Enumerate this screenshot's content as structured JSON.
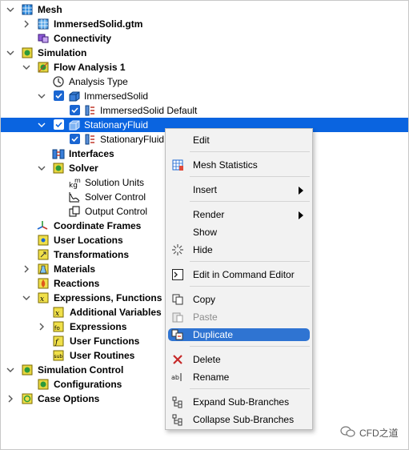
{
  "tree": {
    "items": [
      {
        "label": "Mesh",
        "bold": true
      },
      {
        "label": "ImmersedSolid.gtm",
        "bold": true
      },
      {
        "label": "Connectivity",
        "bold": true
      },
      {
        "label": "Simulation",
        "bold": true
      },
      {
        "label": "Flow Analysis 1",
        "bold": true
      },
      {
        "label": "Analysis Type",
        "bold": false
      },
      {
        "label": "ImmersedSolid",
        "bold": false
      },
      {
        "label": "ImmersedSolid Default",
        "bold": false
      },
      {
        "label": "StationaryFluid",
        "bold": false
      },
      {
        "label": "StationaryFluid D",
        "bold": false
      },
      {
        "label": "Interfaces",
        "bold": true
      },
      {
        "label": "Solver",
        "bold": true
      },
      {
        "label": "Solution Units",
        "bold": false
      },
      {
        "label": "Solver Control",
        "bold": false
      },
      {
        "label": "Output Control",
        "bold": false
      },
      {
        "label": "Coordinate Frames",
        "bold": true
      },
      {
        "label": "User Locations",
        "bold": true
      },
      {
        "label": "Transformations",
        "bold": true
      },
      {
        "label": "Materials",
        "bold": true
      },
      {
        "label": "Reactions",
        "bold": true
      },
      {
        "label": "Expressions, Functions an",
        "bold": true
      },
      {
        "label": "Additional Variables",
        "bold": true
      },
      {
        "label": "Expressions",
        "bold": true
      },
      {
        "label": "User Functions",
        "bold": true
      },
      {
        "label": "User Routines",
        "bold": true
      },
      {
        "label": "Simulation Control",
        "bold": true
      },
      {
        "label": "Configurations",
        "bold": true
      },
      {
        "label": "Case Options",
        "bold": true
      }
    ],
    "selected": "StationaryFluid"
  },
  "context_menu": {
    "items": [
      {
        "label": "Edit"
      },
      {
        "label": "Mesh Statistics",
        "icon": "mesh-statistics-icon"
      },
      {
        "label": "Insert",
        "submenu": true
      },
      {
        "label": "Render",
        "submenu": true
      },
      {
        "label": "Show"
      },
      {
        "label": "Hide",
        "icon": "hide-icon"
      },
      {
        "label": "Edit in Command Editor",
        "icon": "command-editor-icon"
      },
      {
        "label": "Copy",
        "icon": "copy-icon"
      },
      {
        "label": "Paste",
        "icon": "paste-icon",
        "disabled": true
      },
      {
        "label": "Duplicate",
        "icon": "duplicate-icon",
        "highlighted": true
      },
      {
        "label": "Delete",
        "icon": "delete-icon"
      },
      {
        "label": "Rename",
        "icon": "rename-icon"
      },
      {
        "label": "Expand Sub-Branches",
        "icon": "expand-icon"
      },
      {
        "label": "Collapse Sub-Branches",
        "icon": "collapse-icon"
      }
    ]
  },
  "watermark": {
    "text": "CFD之道"
  },
  "colors": {
    "selection": "#0a64e0",
    "menu_highlight": "#2f74d2",
    "menu_bg": "#f2f2f2"
  }
}
